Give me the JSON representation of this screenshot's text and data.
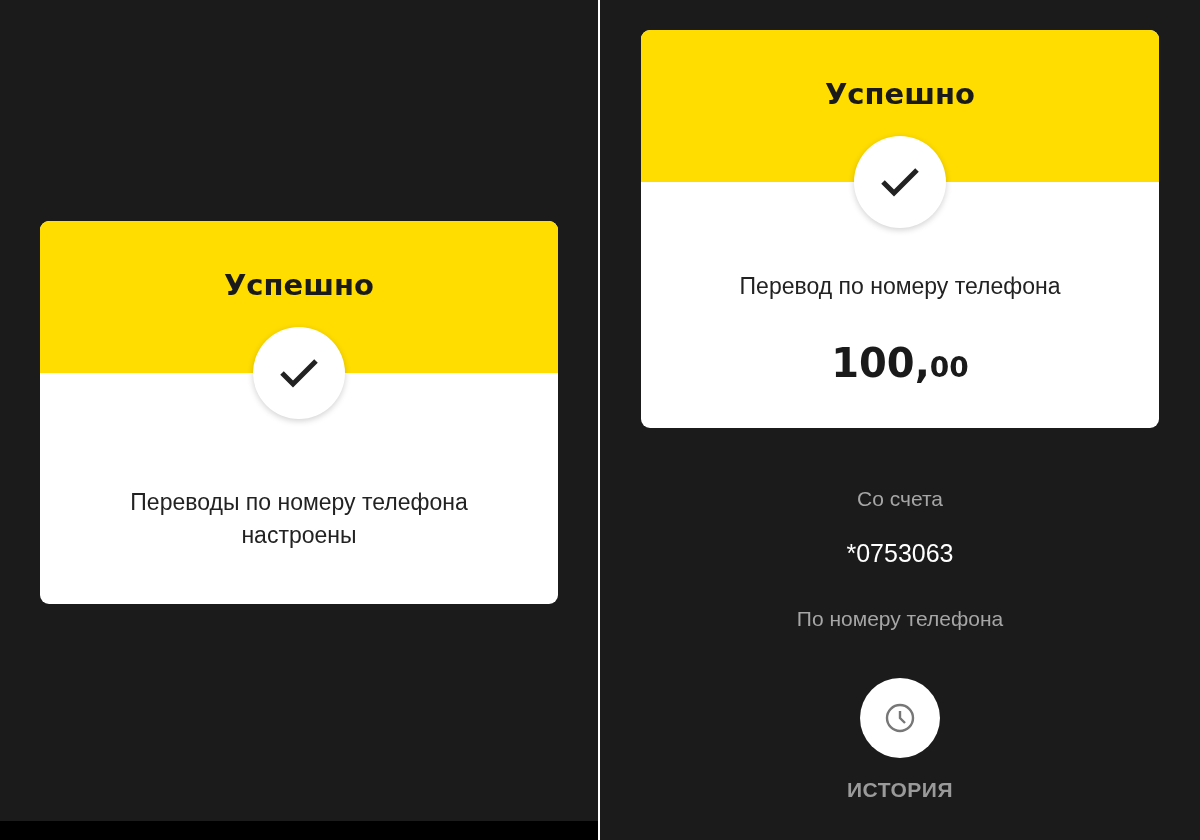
{
  "screens": [
    {
      "card": {
        "title": "Успешно",
        "message": "Переводы по номеру телефона настроены"
      }
    },
    {
      "card": {
        "title": "Успешно",
        "message": "Перевод по номеру телефона",
        "amount_whole": "100,",
        "amount_fraction": "00"
      },
      "details": [
        {
          "kind": "label",
          "text": "Со счета"
        },
        {
          "kind": "value",
          "text": "*0753063"
        },
        {
          "kind": "label",
          "text": "По номеру телефона"
        }
      ],
      "history_button": {
        "label": "ИСТОРИЯ"
      }
    }
  ]
}
